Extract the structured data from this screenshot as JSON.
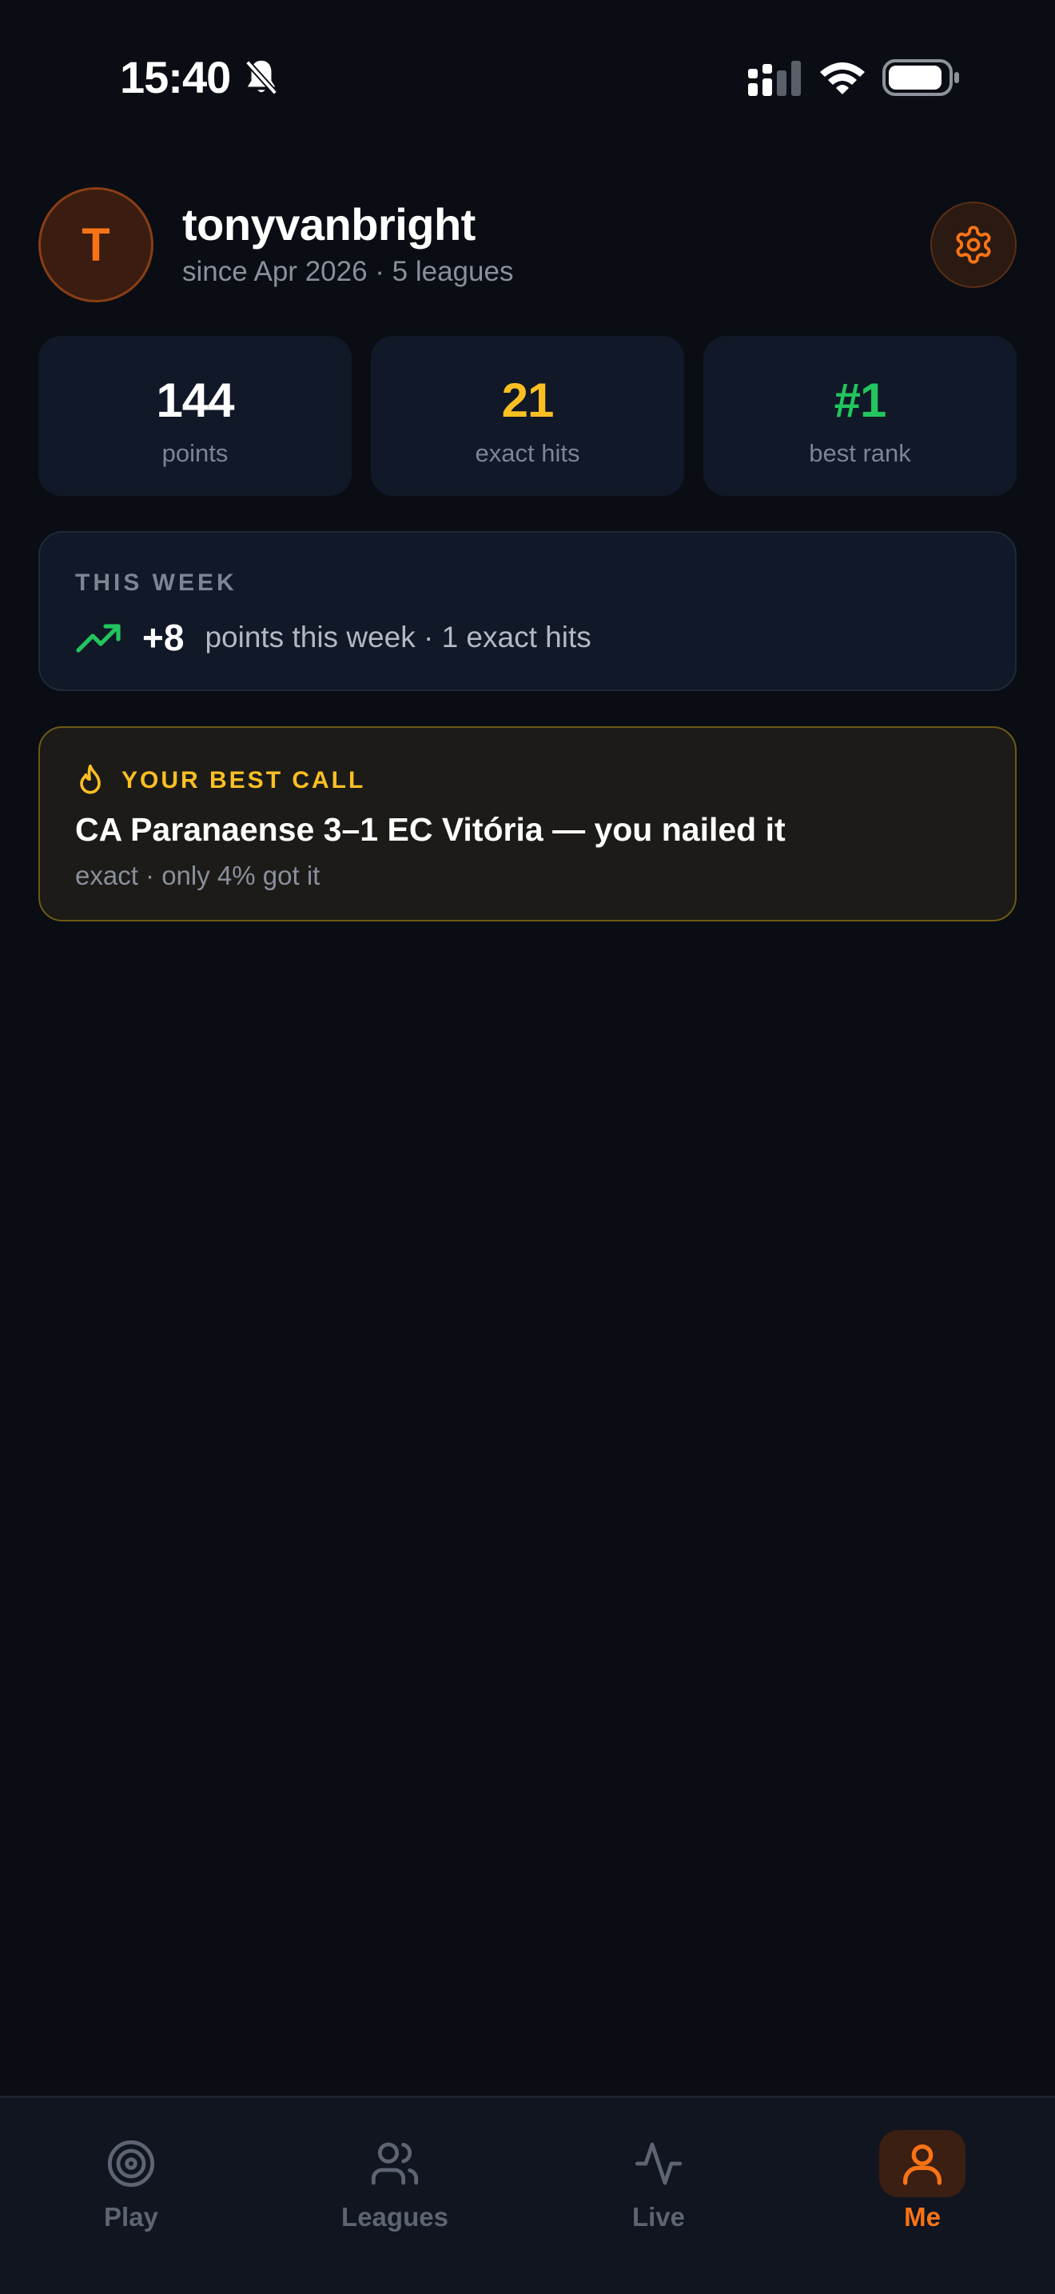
{
  "status_bar": {
    "time": "15:40",
    "icons": [
      "bell-off-icon",
      "signal-icon",
      "wifi-icon",
      "battery-icon"
    ]
  },
  "profile": {
    "avatar_initial": "T",
    "username": "tonyvanbright",
    "meta": "since Apr 2026 · 5 leagues",
    "settings_icon": "gear-icon"
  },
  "stats": [
    {
      "value": "144",
      "label": "points",
      "color": "#ffffff"
    },
    {
      "value": "21",
      "label": "exact hits",
      "color": "#fbbf24"
    },
    {
      "value": "#1",
      "label": "best rank",
      "color": "#22c55e"
    }
  ],
  "this_week": {
    "title": "THIS WEEK",
    "icon": "trending-up-icon",
    "delta": "+8",
    "text": "points this week · 1 exact hits"
  },
  "best_call": {
    "icon": "flame-icon",
    "title": "YOUR BEST CALL",
    "headline": "CA Paranaense 3–1 EC Vitória — you nailed it",
    "sub": "exact · only 4% got it"
  },
  "nav": {
    "items": [
      {
        "label": "Play",
        "icon": "target-icon",
        "active": false
      },
      {
        "label": "Leagues",
        "icon": "users-icon",
        "active": false
      },
      {
        "label": "Live",
        "icon": "activity-icon",
        "active": false
      },
      {
        "label": "Me",
        "icon": "user-icon",
        "active": true
      }
    ]
  },
  "colors": {
    "background": "#0a0d14",
    "card": "#111827",
    "accent": "#f97316",
    "gold": "#fbbf24",
    "green": "#22c55e"
  }
}
